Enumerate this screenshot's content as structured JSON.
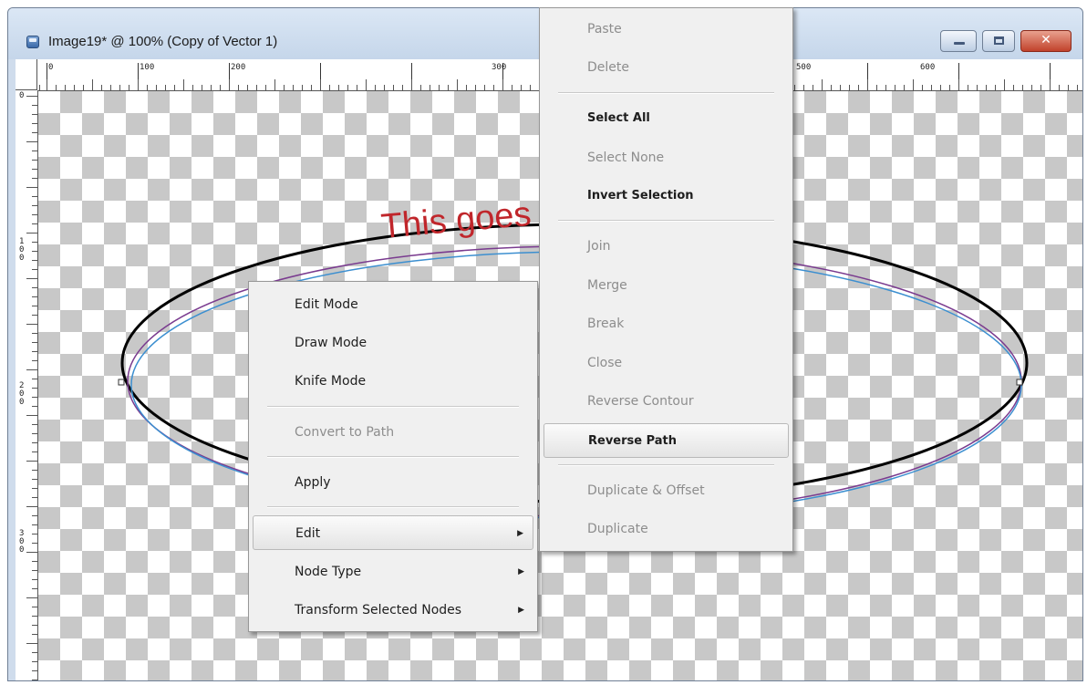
{
  "window": {
    "title": "Image19* @ 100% (Copy of Vector 1)",
    "buttons": {
      "minimize": "–",
      "maximize": "▢",
      "close": "✕"
    }
  },
  "ruler": {
    "h_labels": [
      "0",
      "100",
      "200",
      "300",
      "500",
      "600"
    ],
    "v_labels": [
      "0",
      "100",
      "200",
      "300"
    ]
  },
  "canvas": {
    "text_on_path": "This goes"
  },
  "context_menu": {
    "items": [
      {
        "label": "Edit Mode",
        "enabled": true
      },
      {
        "label": "Draw Mode",
        "enabled": true
      },
      {
        "label": "Knife Mode",
        "enabled": true
      },
      {
        "label": "Convert to Path",
        "enabled": false
      },
      {
        "label": "Apply",
        "enabled": true
      },
      {
        "label": "Edit",
        "enabled": true,
        "submenu": true,
        "highlighted": true
      },
      {
        "label": "Node Type",
        "enabled": true,
        "submenu": true
      },
      {
        "label": "Transform Selected Nodes",
        "enabled": true,
        "submenu": true
      }
    ],
    "submenu_arrow": "▶"
  },
  "edit_submenu": {
    "items": [
      {
        "label": "Paste",
        "enabled": false
      },
      {
        "label": "Delete",
        "enabled": false
      },
      {
        "label": "Select All",
        "enabled": true
      },
      {
        "label": "Select None",
        "enabled": false
      },
      {
        "label": "Invert Selection",
        "enabled": true
      },
      {
        "label": "Join",
        "enabled": false
      },
      {
        "label": "Merge",
        "enabled": false
      },
      {
        "label": "Break",
        "enabled": false
      },
      {
        "label": "Close",
        "enabled": false
      },
      {
        "label": "Reverse Contour",
        "enabled": false
      },
      {
        "label": "Reverse Path",
        "enabled": true,
        "highlighted": true
      },
      {
        "label": "Duplicate & Offset",
        "enabled": false
      },
      {
        "label": "Duplicate",
        "enabled": false
      }
    ]
  },
  "colors": {
    "text_on_path": "#c0262b",
    "ellipse_outer": "#000000",
    "ellipse_inner_a": "#7a3b8f",
    "ellipse_inner_b": "#3c8fd0",
    "checker": "#c8c8c8"
  }
}
